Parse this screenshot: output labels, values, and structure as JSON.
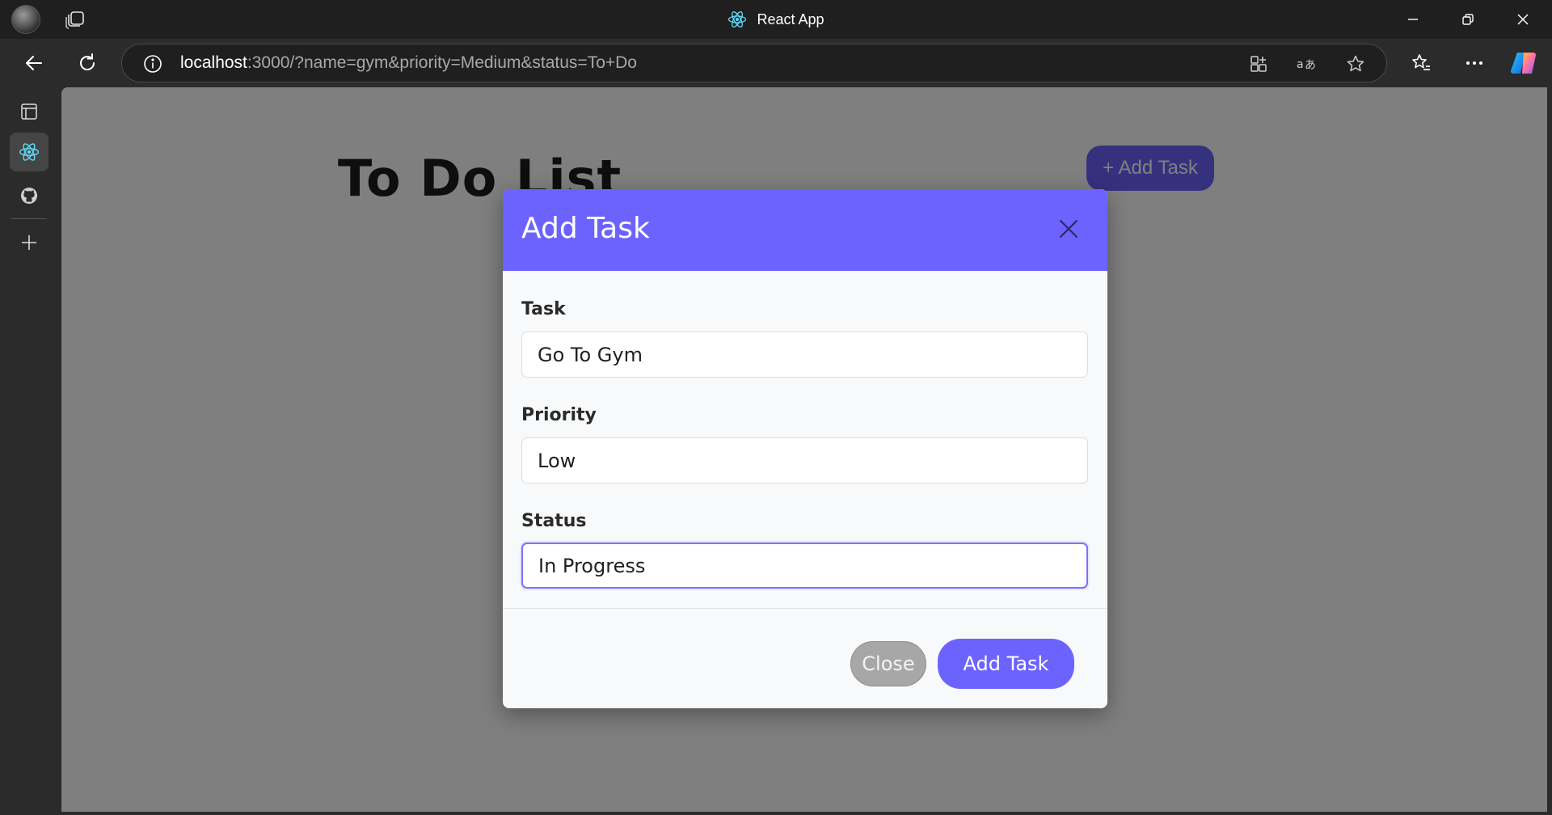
{
  "browser": {
    "window_title": "React App",
    "url_host": "localhost",
    "url_rest": ":3000/?name=gym&priority=Medium&status=To+Do",
    "icons": {
      "profile": "profile-avatar",
      "workspaces": "workspaces-icon",
      "tab": "react-icon",
      "minimize": "minimize-icon",
      "restore": "restore-icon",
      "close": "close-icon",
      "back": "back-arrow-icon",
      "refresh": "refresh-icon",
      "site_info": "info-icon",
      "apps": "app-available-icon",
      "translate": "translate-icon",
      "favorite": "star-icon",
      "favorites": "favorites-icon",
      "menu": "more-icon",
      "copilot": "copilot-icon"
    },
    "sidebar_icons": [
      "panel-icon",
      "react-icon",
      "github-icon",
      "plus-icon"
    ]
  },
  "page": {
    "title": "To Do List",
    "add_button_label": "+ Add Task"
  },
  "modal": {
    "title": "Add Task",
    "fields": {
      "task": {
        "label": "Task",
        "value": "Go To Gym"
      },
      "priority": {
        "label": "Priority",
        "value": "Low"
      },
      "status": {
        "label": "Status",
        "value": "In Progress"
      }
    },
    "close_label": "Close",
    "submit_label": "Add Task"
  },
  "colors": {
    "accent": "#6c63ff",
    "close_button": "#a7a7a7",
    "overlay": "rgba(0,0,0,0.5)",
    "chrome": "#1f1f1f"
  }
}
